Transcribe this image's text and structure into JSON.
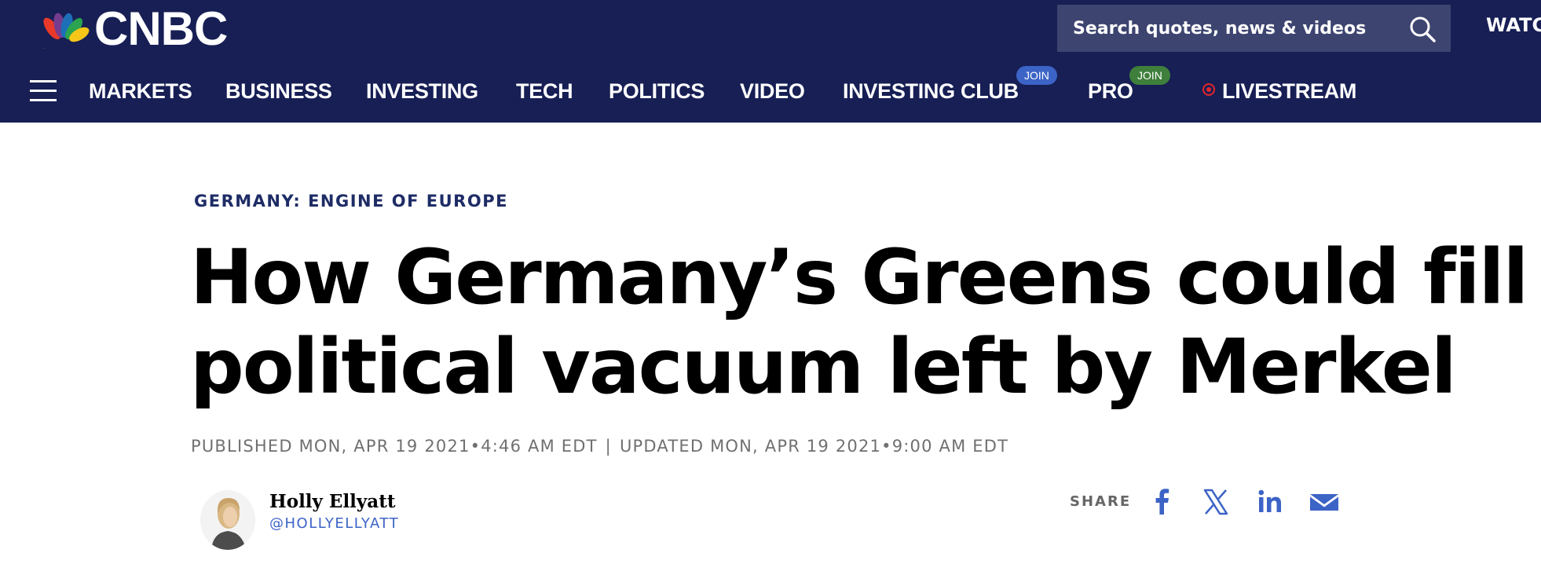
{
  "header": {
    "logo_text": "CNBC",
    "search_placeholder": "Search quotes, news & videos",
    "watch_label": "WATC"
  },
  "nav": {
    "items": [
      "MARKETS",
      "BUSINESS",
      "INVESTING",
      "TECH",
      "POLITICS",
      "VIDEO",
      "INVESTING CLUB",
      "PRO",
      "LIVESTREAM"
    ],
    "join_label": "JOIN"
  },
  "article": {
    "eyebrow": "GERMANY: ENGINE OF EUROPE",
    "headline_line1": "How Germany’s Greens could fill a",
    "headline_line2": "political vacuum left by Merkel",
    "published": "PUBLISHED MON, APR 19 2021•4:46 AM EDT",
    "separator": "|",
    "updated": "UPDATED MON, APR 19 2021•9:00 AM EDT",
    "author_name": "Holly Ellyatt",
    "author_handle": "@HOLLYELLYATT"
  },
  "share": {
    "label": "SHARE",
    "icons": [
      "facebook-icon",
      "x-icon",
      "linkedin-icon",
      "email-icon"
    ]
  },
  "colors": {
    "header_bg": "#171f55",
    "accent_blue": "#3c63c6",
    "join_green": "#3f7f3c",
    "live_red": "#e5252b"
  }
}
